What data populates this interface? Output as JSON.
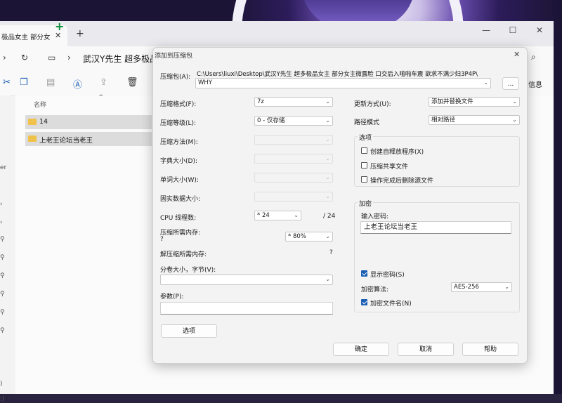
{
  "explorer": {
    "tab_label": "极品女主 部分女",
    "addr_path": "武汉Y先生 超多极品",
    "toolbar_right": "信息",
    "sidebar_marks": [
      "er",
      ")",
      ":)"
    ],
    "column_name": "名称",
    "rows": [
      "14",
      "上老王论坛当老王"
    ]
  },
  "dialog": {
    "title": "添加到压缩包",
    "archive_label": "压缩包(A):",
    "archive_path": "C:\\Users\\liuxi\\Desktop\\武汉Y先生 超多极品女主 部分女主微露脸 口交后入啪啪车震 欲求不满少妇3P4P\\",
    "archive_name": "WHY",
    "browse_label": "...",
    "left": {
      "format_label": "压缩格式(F):",
      "format_value": "7z",
      "level_label": "压缩等级(L):",
      "level_value": "0 - 仅存储",
      "method_label": "压缩方法(M):",
      "dict_label": "字典大小(D):",
      "word_label": "单词大小(W):",
      "solid_label": "固实数据大小:",
      "threads_label": "CPU 线程数:",
      "threads_value": "* 24",
      "threads_total": "/ 24",
      "mem_label": "压缩所需内存:",
      "mem_q": "?",
      "mem_value": "* 80%",
      "dmem_label": "解压缩所需内存:",
      "dmem_q": "?",
      "split_label": "分卷大小，字节(V):",
      "params_label": "参数(P):",
      "options_button": "选项"
    },
    "right": {
      "update_label": "更新方式(U):",
      "update_value": "添加并替换文件",
      "pathmode_label": "路径模式",
      "pathmode_value": "相对路径",
      "options_title": "选项",
      "opt_sfx": "创建自释放程序(X)",
      "opt_shared": "压缩共享文件",
      "opt_delete": "操作完成后删除源文件",
      "enc_title": "加密",
      "pwd_label": "输入密码:",
      "pwd_value": "上老王论坛当老王",
      "show_pwd": "显示密码(S)",
      "algo_label": "加密算法:",
      "algo_value": "AES-256",
      "enc_names": "加密文件名(N)"
    },
    "buttons": {
      "ok": "确定",
      "cancel": "取消",
      "help": "帮助"
    }
  }
}
